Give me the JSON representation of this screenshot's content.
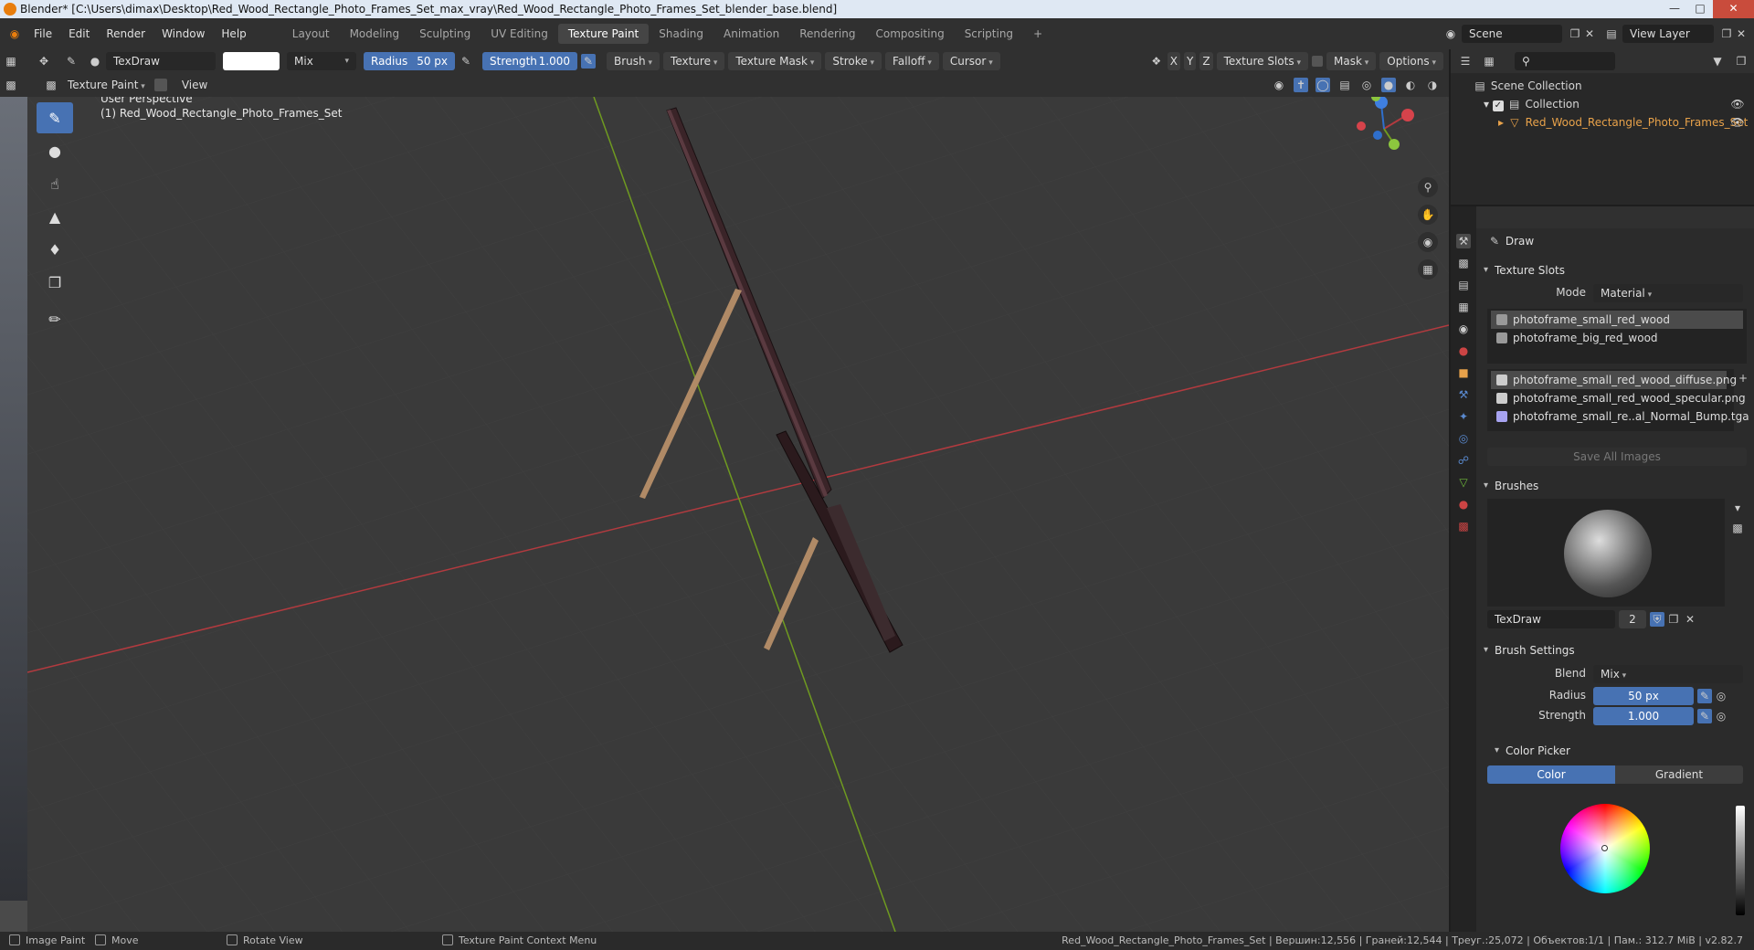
{
  "window": {
    "title": "Blender* [C:\\Users\\dimax\\Desktop\\Red_Wood_Rectangle_Photo_Frames_Set_max_vray\\Red_Wood_Rectangle_Photo_Frames_Set_blender_base.blend]"
  },
  "menu": [
    "File",
    "Edit",
    "Render",
    "Window",
    "Help"
  ],
  "workspaces": [
    "Layout",
    "Modeling",
    "Sculpting",
    "UV Editing",
    "Texture Paint",
    "Shading",
    "Animation",
    "Rendering",
    "Compositing",
    "Scripting",
    "+"
  ],
  "active_workspace": "Texture Paint",
  "scene": {
    "label": "Scene",
    "view_layer": "View Layer"
  },
  "toolbar": {
    "brush_name": "TexDraw",
    "blend": "Mix",
    "radius_label": "Radius",
    "radius_value": "50 px",
    "strength_label": "Strength",
    "strength_value": "1.000",
    "menus": [
      "Brush",
      "Texture",
      "Texture Mask",
      "Stroke",
      "Falloff",
      "Cursor"
    ],
    "axes": [
      "X",
      "Y",
      "Z"
    ],
    "texture_slots": "Texture Slots",
    "mask": "Mask",
    "options": "Options"
  },
  "toolbar2": {
    "mode": "Texture Paint",
    "view": "View"
  },
  "viewport": {
    "perspective": "User Perspective",
    "object": "(1) Red_Wood_Rectangle_Photo_Frames_Set"
  },
  "outliner": {
    "scene_collection": "Scene Collection",
    "collection": "Collection",
    "object": "Red_Wood_Rectangle_Photo_Frames_Set"
  },
  "properties": {
    "tool": "Draw",
    "texture_slots_title": "Texture Slots",
    "mode_label": "Mode",
    "mode_value": "Material",
    "materials": [
      "photoframe_small_red_wood",
      "photoframe_big_red_wood"
    ],
    "images": [
      "photoframe_small_red_wood_diffuse.png",
      "photoframe_small_red_wood_specular.png",
      "photoframe_small_re..al_Normal_Bump.tga"
    ],
    "save_all": "Save All Images",
    "brushes_title": "Brushes",
    "brush_name": "TexDraw",
    "brush_users": "2",
    "brush_settings_title": "Brush Settings",
    "blend_label": "Blend",
    "blend_value": "Mix",
    "radius_label": "Radius",
    "radius_value": "50 px",
    "strength_label": "Strength",
    "strength_value": "1.000",
    "color_picker_title": "Color Picker",
    "color_tab": "Color",
    "gradient_tab": "Gradient"
  },
  "statusbar": {
    "left": [
      "Image Paint",
      "Move",
      "Rotate View",
      "Texture Paint Context Menu"
    ],
    "right": "Red_Wood_Rectangle_Photo_Frames_Set | Вершин:12,556 | Граней:12,544 | Треуг.:25,072 | Объектов:1/1 | Пам.: 312.7 MiB | v2.82.7"
  },
  "colors": {
    "accent": "#4772b3",
    "x_axis": "#b23a3f",
    "y_axis": "#6f9a20",
    "frame": "#3a2428",
    "stand": "#b08a66"
  }
}
